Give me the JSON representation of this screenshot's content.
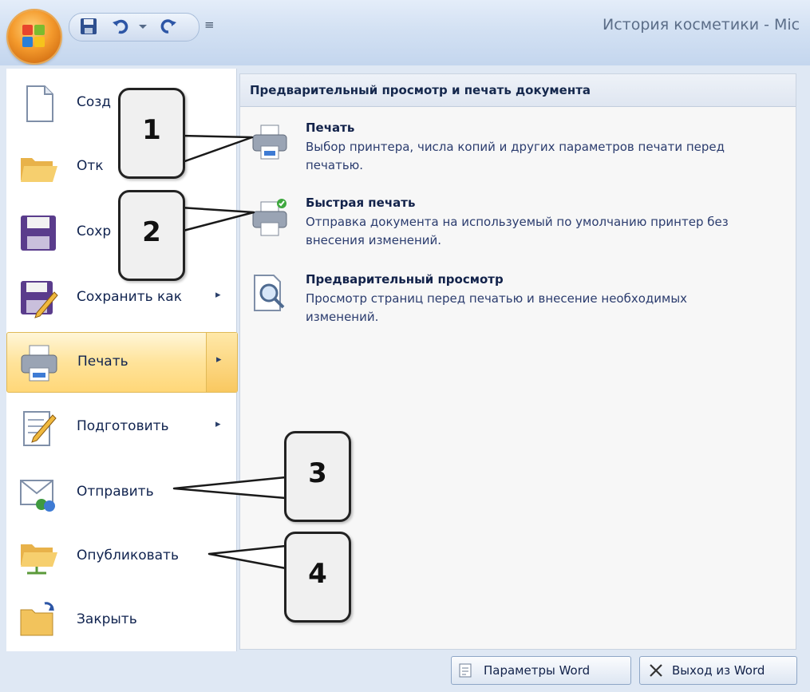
{
  "window": {
    "title": "История косметики - Mic"
  },
  "left_menu": {
    "items": [
      {
        "label": "Созд",
        "icon": "new-document-icon"
      },
      {
        "label": "Отк",
        "icon": "open-folder-icon"
      },
      {
        "label": "Сохр",
        "icon": "save-icon"
      },
      {
        "label": "Сохранить как",
        "icon": "save-as-icon",
        "arrow": "▸"
      },
      {
        "label": "Печать",
        "icon": "printer-icon",
        "arrow": "▸"
      },
      {
        "label": "Подготовить",
        "icon": "prepare-icon",
        "arrow": "▸"
      },
      {
        "label": "Отправить",
        "icon": "send-icon"
      },
      {
        "label": "Опубликовать",
        "icon": "publish-icon"
      },
      {
        "label": "Закрыть",
        "icon": "close-folder-icon"
      }
    ]
  },
  "print_panel": {
    "header": "Предварительный просмотр и печать документа",
    "items": [
      {
        "title": "Печать",
        "desc": "Выбор принтера, числа копий и других параметров печати перед печатью.",
        "icon": "printer-icon"
      },
      {
        "title": "Быстрая печать",
        "desc": "Отправка документа на используемый по умолчанию принтер без внесения изменений.",
        "icon": "quick-print-icon"
      },
      {
        "title": "Предварительный просмотр",
        "desc": "Просмотр страниц перед печатью и внесение необходимых изменений.",
        "icon": "print-preview-icon"
      }
    ]
  },
  "bottom_bar": {
    "options_label": "Параметры Word",
    "exit_label": "Выход из Word"
  },
  "callouts": [
    "1",
    "2",
    "3",
    "4"
  ],
  "colors": {
    "active_highlight": "#ffd778",
    "title_bar": "#d3e1f3",
    "accent_office": "#f49a2c"
  }
}
